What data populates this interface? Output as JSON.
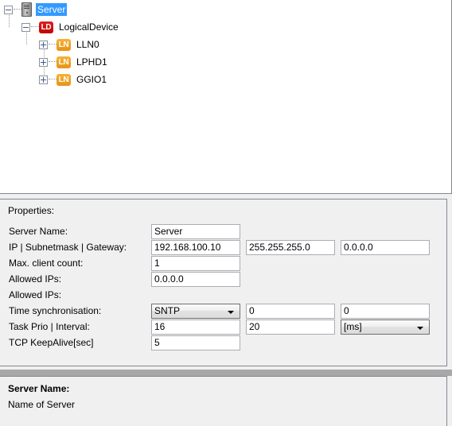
{
  "tree": {
    "nodes": [
      {
        "label": "Server",
        "icon": "server-icon",
        "expander": "minus",
        "selected": true,
        "indent": 0
      },
      {
        "label": "LogicalDevice",
        "icon": "ld-badge-icon",
        "expander": "minus",
        "selected": false,
        "indent": 1
      },
      {
        "label": "LLN0",
        "icon": "ln-badge-icon",
        "expander": "plus",
        "selected": false,
        "indent": 2
      },
      {
        "label": "LPHD1",
        "icon": "ln-badge-icon",
        "expander": "plus",
        "selected": false,
        "indent": 2
      },
      {
        "label": "GGIO1",
        "icon": "ln-badge-icon",
        "expander": "plus",
        "selected": false,
        "indent": 2
      }
    ],
    "badges": {
      "ld": "LD",
      "ln": "LN"
    }
  },
  "properties": {
    "title": "Properties:",
    "rows": [
      {
        "label": "Server Name:",
        "fields": [
          {
            "type": "text",
            "value": "Server"
          }
        ]
      },
      {
        "label": "IP | Subnetmask | Gateway:",
        "fields": [
          {
            "type": "text",
            "value": "192.168.100.10"
          },
          {
            "type": "text",
            "value": "255.255.255.0"
          },
          {
            "type": "text",
            "value": "0.0.0.0"
          }
        ]
      },
      {
        "label": "Max. client count:",
        "fields": [
          {
            "type": "text",
            "value": "1"
          }
        ]
      },
      {
        "label": "Allowed IPs:",
        "fields": [
          {
            "type": "text",
            "value": "0.0.0.0"
          }
        ]
      },
      {
        "label": "Allowed IPs:",
        "fields": []
      },
      {
        "label": "Time synchronisation:",
        "fields": [
          {
            "type": "combo",
            "value": "SNTP"
          },
          {
            "type": "text",
            "value": "0"
          },
          {
            "type": "text",
            "value": "0"
          }
        ]
      },
      {
        "label": "Task Prio | Interval:",
        "fields": [
          {
            "type": "text",
            "value": "16"
          },
          {
            "type": "text",
            "value": "20"
          },
          {
            "type": "combo",
            "value": "[ms]"
          }
        ]
      },
      {
        "label": "TCP KeepAlive[sec]",
        "fields": [
          {
            "type": "text",
            "value": "5"
          }
        ]
      }
    ]
  },
  "description": {
    "title": "Server Name:",
    "text": "Name of Server"
  },
  "colors": {
    "selection": "#3399ff",
    "ld_badge": "#d81313",
    "ln_badge": "#eda029",
    "panel_bg": "#f0f0f0",
    "splitter": "#a8a8a8"
  }
}
